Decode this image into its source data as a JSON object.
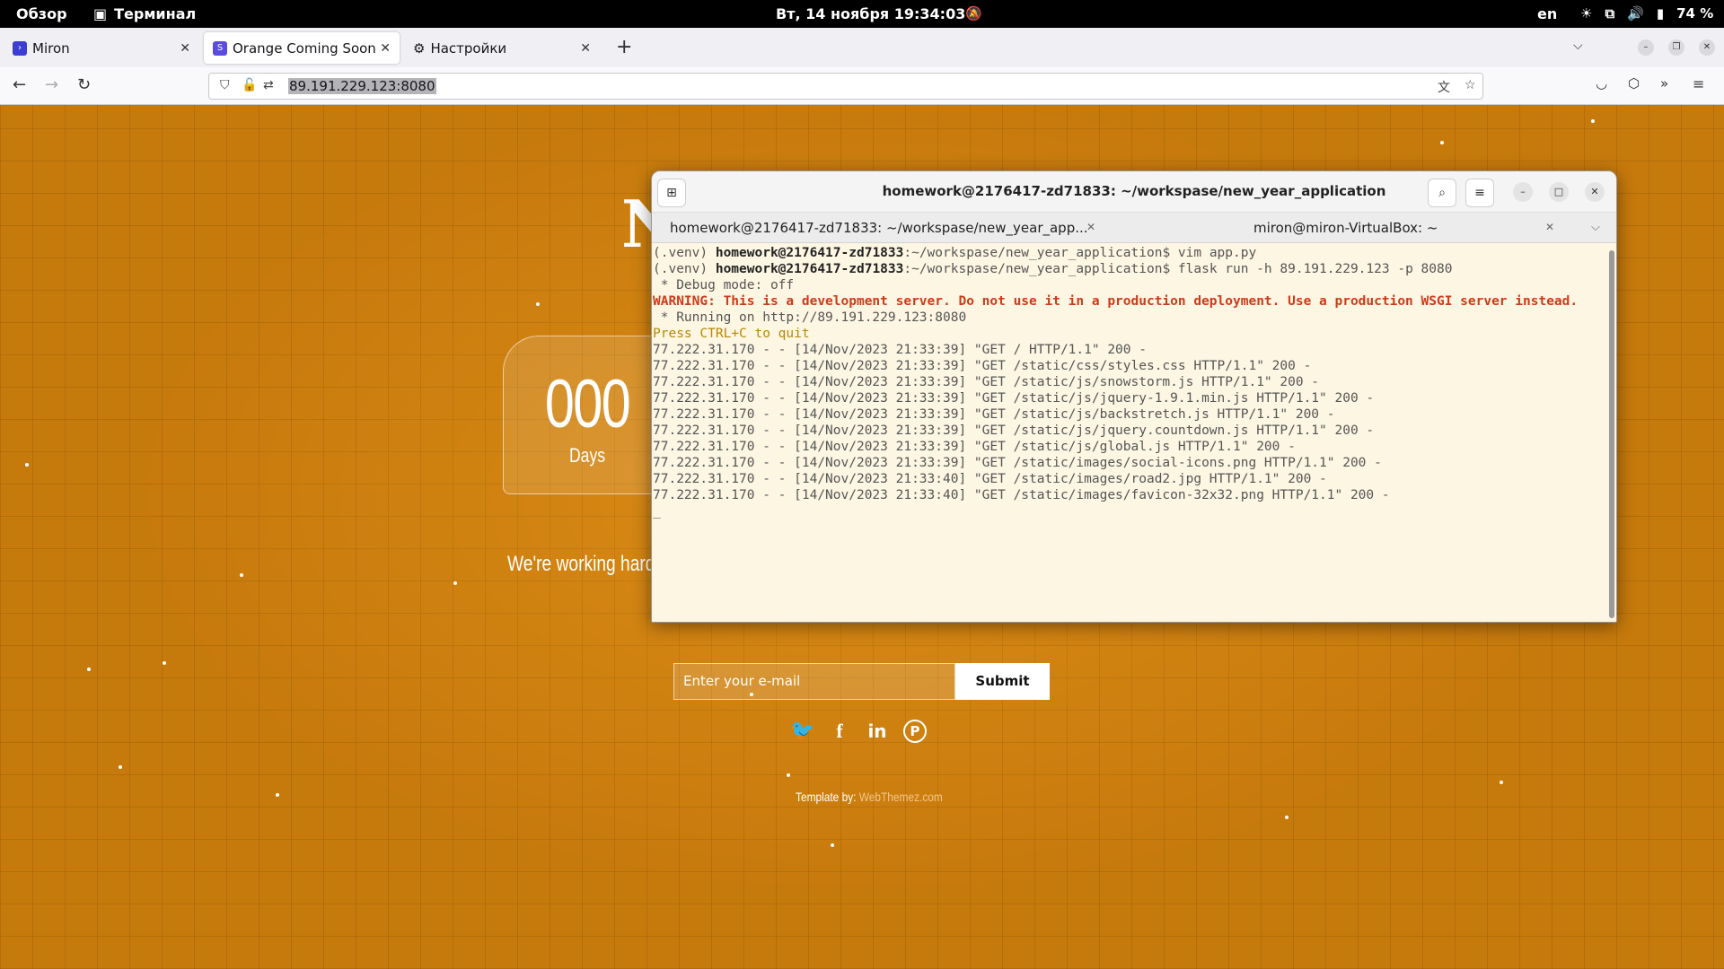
{
  "topbar": {
    "activities": "Обзор",
    "app": "Терминал",
    "clock": "Вт, 14 ноября  19:34:03",
    "lang": "en",
    "battery": "74 %"
  },
  "browser": {
    "tabs": [
      {
        "title": "Miron",
        "fav_color": "#3d3dd1",
        "fav_icon": "terminal-icon"
      },
      {
        "title": "Orange Coming Soon | Free Template",
        "fav_color": "#5b4ce0",
        "fav_icon": "s-icon"
      },
      {
        "title": "Настройки",
        "fav_icon": "gear-icon"
      }
    ],
    "url": "89.191.229.123:8080"
  },
  "page": {
    "headline": "N",
    "days_value": "000",
    "days_label": "Days",
    "working_text": "We're working hard t",
    "email_placeholder": "Enter your e-mail",
    "submit_label": "Submit",
    "social": [
      "twitter-icon",
      "facebook-icon",
      "linkedin-icon",
      "pinterest-icon"
    ],
    "credit_prefix": "Template by: ",
    "credit_link": "WebThemez.com"
  },
  "terminal": {
    "title": "homework@2176417-zd71833: ~/workspase/new_year_application",
    "tabs": [
      "homework@2176417-zd71833: ~/workspase/new_year_app...",
      "miron@miron-VirtualBox: ~"
    ],
    "lines": [
      {
        "pre": "(.venv) ",
        "host": "homework@2176417-zd71833",
        "rest": ":~/workspase/new_year_application$ vim app.py"
      },
      {
        "pre": "(.venv) ",
        "host": "homework@2176417-zd71833",
        "rest": ":~/workspase/new_year_application$ flask run -h 89.191.229.123 -p 8080"
      },
      {
        "text": " * Debug mode: off"
      },
      {
        "warn": "WARNING: This is a development server. Do not use it in a production deployment. Use a production WSGI server instead."
      },
      {
        "text": " * Running on http://89.191.229.123:8080"
      },
      {
        "yel": "Press CTRL+C to quit"
      },
      {
        "text": "77.222.31.170 - - [14/Nov/2023 21:33:39] \"GET / HTTP/1.1\" 200 -"
      },
      {
        "text": "77.222.31.170 - - [14/Nov/2023 21:33:39] \"GET /static/css/styles.css HTTP/1.1\" 200 -"
      },
      {
        "text": "77.222.31.170 - - [14/Nov/2023 21:33:39] \"GET /static/js/snowstorm.js HTTP/1.1\" 200 -"
      },
      {
        "text": "77.222.31.170 - - [14/Nov/2023 21:33:39] \"GET /static/js/jquery-1.9.1.min.js HTTP/1.1\" 200 -"
      },
      {
        "text": "77.222.31.170 - - [14/Nov/2023 21:33:39] \"GET /static/js/backstretch.js HTTP/1.1\" 200 -"
      },
      {
        "text": "77.222.31.170 - - [14/Nov/2023 21:33:39] \"GET /static/js/jquery.countdown.js HTTP/1.1\" 200 -"
      },
      {
        "text": "77.222.31.170 - - [14/Nov/2023 21:33:39] \"GET /static/js/global.js HTTP/1.1\" 200 -"
      },
      {
        "text": "77.222.31.170 - - [14/Nov/2023 21:33:39] \"GET /static/images/social-icons.png HTTP/1.1\" 200 -"
      },
      {
        "text": "77.222.31.170 - - [14/Nov/2023 21:33:40] \"GET /static/images/road2.jpg HTTP/1.1\" 200 -"
      },
      {
        "text": "77.222.31.170 - - [14/Nov/2023 21:33:40] \"GET /static/images/favicon-32x32.png HTTP/1.1\" 200 -"
      },
      {
        "text": "_"
      }
    ]
  }
}
